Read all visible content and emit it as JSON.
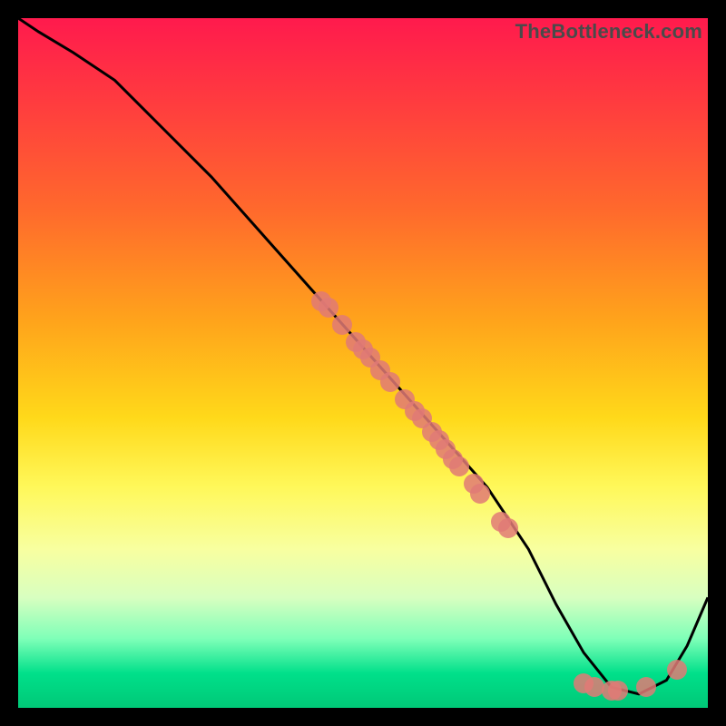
{
  "watermark": "TheBottleneck.com",
  "chart_data": {
    "type": "line",
    "title": "",
    "xlabel": "",
    "ylabel": "",
    "xlim": [
      0,
      100
    ],
    "ylim": [
      0,
      100
    ],
    "grid": false,
    "series": [
      {
        "name": "bottleneck-curve",
        "x": [
          0,
          3,
          8,
          14,
          20,
          28,
          36,
          44,
          52,
          60,
          68,
          74,
          78,
          82,
          86,
          90,
          94,
          97,
          100
        ],
        "y": [
          100,
          98,
          95,
          91,
          85,
          77,
          68,
          59,
          50,
          41,
          32,
          23,
          15,
          8,
          3,
          2,
          4,
          9,
          16
        ]
      }
    ],
    "markers": [
      {
        "x": 44.0,
        "y": 59.0
      },
      {
        "x": 45.0,
        "y": 58.0
      },
      {
        "x": 47.0,
        "y": 55.5
      },
      {
        "x": 49.0,
        "y": 53.0
      },
      {
        "x": 50.0,
        "y": 52.0
      },
      {
        "x": 51.0,
        "y": 50.8
      },
      {
        "x": 52.5,
        "y": 49.0
      },
      {
        "x": 54.0,
        "y": 47.3
      },
      {
        "x": 56.0,
        "y": 44.8
      },
      {
        "x": 57.5,
        "y": 43.0
      },
      {
        "x": 58.5,
        "y": 42.0
      },
      {
        "x": 60.0,
        "y": 40.0
      },
      {
        "x": 61.0,
        "y": 38.8
      },
      {
        "x": 62.0,
        "y": 37.5
      },
      {
        "x": 63.0,
        "y": 36.0
      },
      {
        "x": 64.0,
        "y": 35.0
      },
      {
        "x": 66.0,
        "y": 32.5
      },
      {
        "x": 67.0,
        "y": 31.0
      },
      {
        "x": 70.0,
        "y": 27.0
      },
      {
        "x": 71.0,
        "y": 26.0
      },
      {
        "x": 82.0,
        "y": 3.5
      },
      {
        "x": 83.5,
        "y": 3.0
      },
      {
        "x": 86.0,
        "y": 2.5
      },
      {
        "x": 87.0,
        "y": 2.5
      },
      {
        "x": 91.0,
        "y": 3.0
      },
      {
        "x": 95.5,
        "y": 5.5
      }
    ],
    "marker_color": "#e17a75",
    "line_color": "#000000",
    "gradient_stops": [
      {
        "pos": 0.0,
        "color": "#ff1a4d"
      },
      {
        "pos": 0.28,
        "color": "#ff6a2c"
      },
      {
        "pos": 0.58,
        "color": "#ffd91a"
      },
      {
        "pos": 0.84,
        "color": "#d8ffc0"
      },
      {
        "pos": 1.0,
        "color": "#00c877"
      }
    ]
  }
}
